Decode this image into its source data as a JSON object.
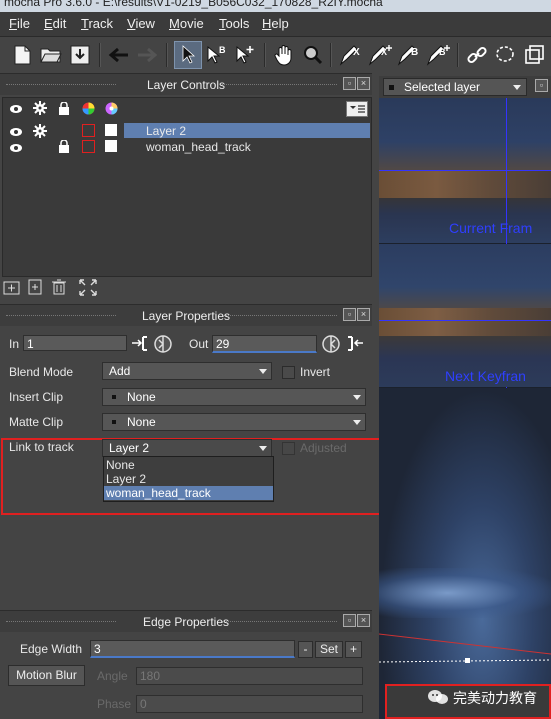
{
  "window": {
    "title": "mocha Pro 3.6.0 - E:\\results\\V1-0219_B056C032_170828_R2IY.mocha"
  },
  "menu": [
    "File",
    "Edit",
    "Track",
    "View",
    "Movie",
    "Tools",
    "Help"
  ],
  "toolbar": {
    "icons": [
      "new-file-icon",
      "open-folder-icon",
      "save-icon",
      "back-arrow-icon",
      "forward-arrow-icon",
      "select-pointer-icon",
      "select-b-pointer-icon",
      "add-point-icon",
      "hand-pan-icon",
      "zoom-icon",
      "pen-x-icon",
      "pen-x-plus-icon",
      "pen-b-icon",
      "pen-b-plus-icon",
      "link-icon",
      "lasso-icon",
      "crop-icon"
    ],
    "b_label": "B",
    "x_label": "X"
  },
  "layer_controls": {
    "title": "Layer Controls",
    "layers": [
      {
        "name": "Layer 2",
        "selected": true
      },
      {
        "name": "woman_head_track",
        "selected": false
      }
    ]
  },
  "viewer": {
    "selector": "Selected layer",
    "labels": [
      "Current Fram",
      "Next Keyfran"
    ]
  },
  "layer_properties": {
    "title": "Layer Properties",
    "in_label": "In",
    "in_value": "1",
    "out_label": "Out",
    "out_value": "29",
    "blend_mode_label": "Blend Mode",
    "blend_mode_value": "Add",
    "invert_label": "Invert",
    "insert_clip_label": "Insert Clip",
    "insert_clip_value": "None",
    "matte_clip_label": "Matte Clip",
    "matte_clip_value": "None",
    "link_to_track_label": "Link to track",
    "link_to_track_value": "Layer 2",
    "adjusted_label": "Adjusted",
    "dropdown_options": [
      "None",
      "Layer 2",
      "woman_head_track"
    ],
    "highlighted_option_index": 2
  },
  "edge_properties": {
    "title": "Edge Properties",
    "edge_width_label": "Edge Width",
    "edge_width_value": "3",
    "minus_label": "-",
    "set_label": "Set",
    "plus_label": "+",
    "motion_blur_label": "Motion Blur",
    "angle_label": "Angle",
    "angle_value": "180",
    "phase_label": "Phase",
    "phase_value": "0"
  },
  "watermark": {
    "text": "完美动力教育"
  },
  "colors": {
    "accent": "#5b7fb8",
    "highlight_row": "#5f7fb0",
    "annotation": "#e02020",
    "guide": "#2a2aff"
  }
}
